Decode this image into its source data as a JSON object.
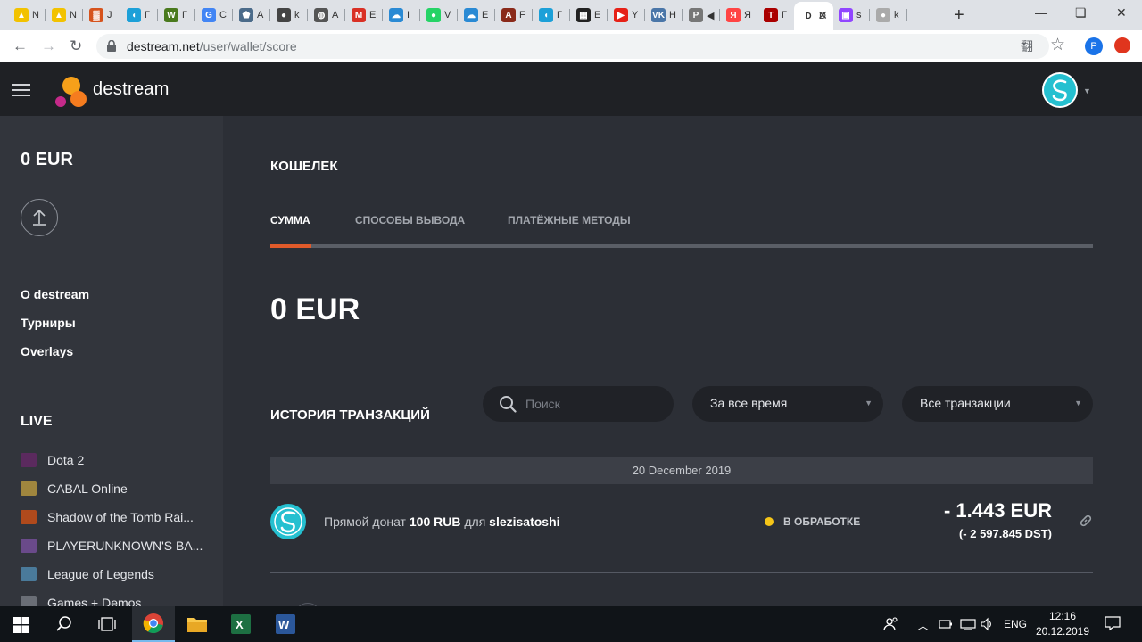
{
  "browser": {
    "tabs": [
      {
        "title": "N",
        "color": "#f2c200",
        "glyph": "▲"
      },
      {
        "title": "N",
        "color": "#f2c200",
        "glyph": "▲"
      },
      {
        "title": "J",
        "color": "#d6531d",
        "glyph": "▓"
      },
      {
        "title": "Г",
        "color": "#1ca0d8",
        "glyph": "◖"
      },
      {
        "title": "Г",
        "color": "#4a7a1e",
        "glyph": "W"
      },
      {
        "title": "C",
        "color": "#4285f4",
        "glyph": "G"
      },
      {
        "title": "A",
        "color": "#4b6b8a",
        "glyph": "⬟"
      },
      {
        "title": "k",
        "color": "#444",
        "glyph": "●"
      },
      {
        "title": "A",
        "color": "#555",
        "glyph": "◍"
      },
      {
        "title": "E",
        "color": "#d93025",
        "glyph": "M"
      },
      {
        "title": "I",
        "color": "#2a8ad4",
        "glyph": "☁"
      },
      {
        "title": "V",
        "color": "#25d366",
        "glyph": "●"
      },
      {
        "title": "E",
        "color": "#2a8ad4",
        "glyph": "☁"
      },
      {
        "title": "F",
        "color": "#8a2a1a",
        "glyph": "A"
      },
      {
        "title": "Г",
        "color": "#1ca0d8",
        "glyph": "◖"
      },
      {
        "title": "E",
        "color": "#222",
        "glyph": "▦"
      },
      {
        "title": "Y",
        "color": "#e62117",
        "glyph": "▶"
      },
      {
        "title": "H",
        "color": "#4a76a8",
        "glyph": "VK"
      },
      {
        "title": "◀",
        "color": "#777",
        "glyph": "P"
      },
      {
        "title": "Я",
        "color": "#f44",
        "glyph": "Я"
      },
      {
        "title": "Г",
        "color": "#a00",
        "glyph": "T"
      },
      {
        "title": "D",
        "color": "#fff",
        "glyph": "D",
        "active": true
      },
      {
        "title": "s",
        "color": "#9146ff",
        "glyph": "▣"
      },
      {
        "title": "k",
        "color": "#aaa",
        "glyph": "●"
      }
    ],
    "new_tab": "+",
    "window_controls": {
      "minimize": "—",
      "restore": "❏",
      "close": "✕"
    },
    "url_host": "destream.net",
    "url_path": "/user/wallet/score",
    "nav": {
      "back": "←",
      "forward": "→",
      "reload": "↻"
    },
    "icons": {
      "translate": "翻",
      "star": "☆",
      "profile": "P"
    }
  },
  "app": {
    "brand": "destream",
    "sidebar": {
      "balance": "0 EUR",
      "links": [
        "O destream",
        "Турниры",
        "Overlays"
      ],
      "live_heading": "LIVE",
      "games": [
        {
          "name": "Dota 2",
          "color": "#5b2a5e"
        },
        {
          "name": "CABAL Online",
          "color": "#a0863e"
        },
        {
          "name": "Shadow of the Tomb Rai...",
          "color": "#b04a1c"
        },
        {
          "name": "PLAYERUNKNOWN'S BA...",
          "color": "#6a4a8a"
        },
        {
          "name": "League of Legends",
          "color": "#4a7a9a"
        },
        {
          "name": "Games + Demos",
          "color": "#6a6e76"
        }
      ]
    },
    "main": {
      "title": "КОШЕЛЕК",
      "tabs": [
        "СУММА",
        "СПОСОБЫ ВЫВОДА",
        "ПЛАТЁЖНЫЕ МЕТОДЫ"
      ],
      "balance": "0 EUR",
      "history_title": "ИСТОРИЯ ТРАНЗАКЦИЙ",
      "search_placeholder": "Поиск",
      "period_filter": "За все время",
      "type_filter": "Все транзакции",
      "date_group": "20 December 2019",
      "transaction": {
        "prefix": "Прямой донат",
        "amount_rub": "100 RUB",
        "middle": "для",
        "recipient": "slezisatoshi",
        "status": "В ОБРАБОТКЕ",
        "amount_eur": "- 1.443 EUR",
        "amount_dst": "(- 2 597.845 DST)"
      }
    }
  },
  "taskbar": {
    "lang": "ENG",
    "time": "12:16",
    "date": "20.12.2019"
  }
}
